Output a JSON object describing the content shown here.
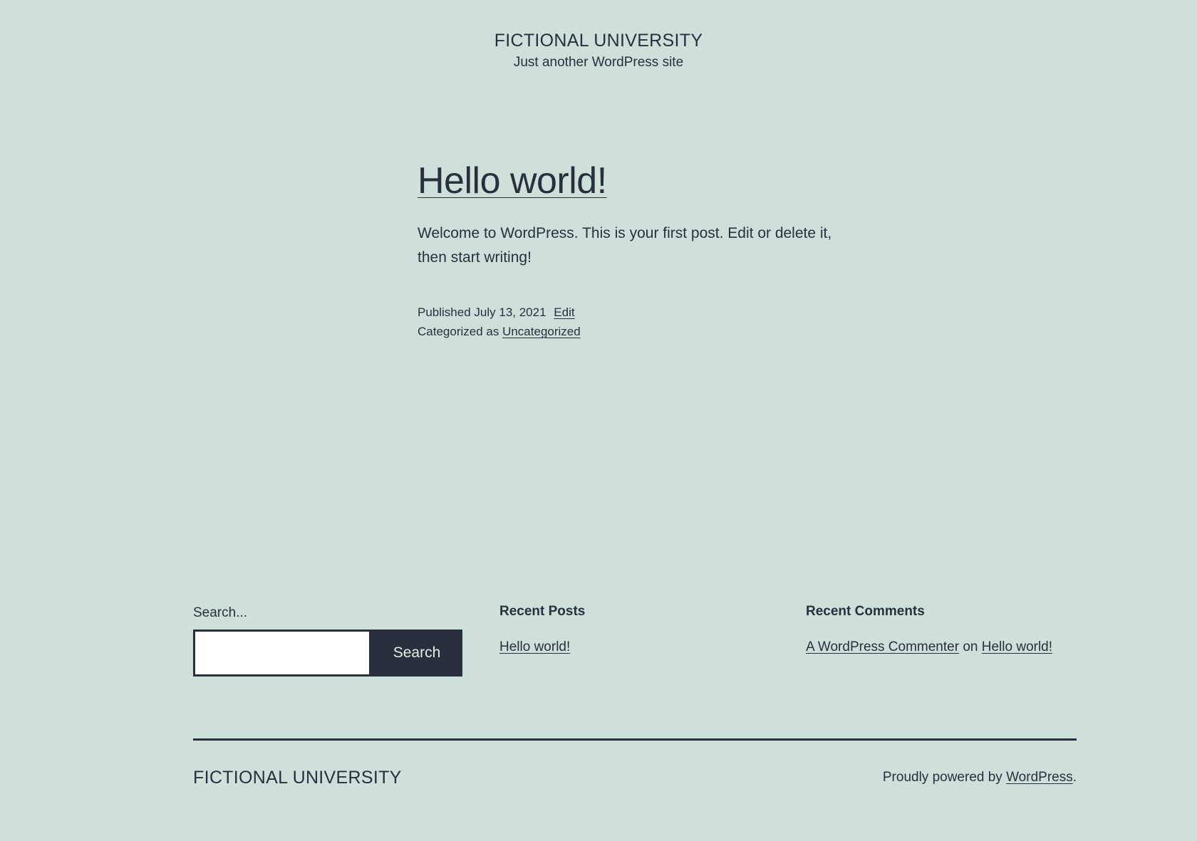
{
  "header": {
    "site_title": "FICTIONAL UNIVERSITY",
    "tagline": "Just another WordPress site"
  },
  "post": {
    "title": "Hello world!",
    "body": "Welcome to WordPress. This is your first post. Edit or delete it, then start writing!",
    "published_prefix": "Published",
    "published_date": "July 13, 2021",
    "edit_label": "Edit",
    "categorized_prefix": "Categorized as",
    "category": "Uncategorized"
  },
  "widgets": {
    "search": {
      "label": "Search...",
      "button_label": "Search",
      "value": ""
    },
    "recent_posts": {
      "title": "Recent Posts",
      "items": [
        "Hello world!"
      ]
    },
    "recent_comments": {
      "title": "Recent Comments",
      "author": "A WordPress Commenter",
      "on_word": "on",
      "post": "Hello world!"
    }
  },
  "footer": {
    "site_title": "FICTIONAL UNIVERSITY",
    "powered_prefix": "Proudly powered by",
    "powered_link": "WordPress",
    "powered_suffix": "."
  },
  "colors": {
    "background": "#cde1da",
    "text": "#28303d"
  }
}
